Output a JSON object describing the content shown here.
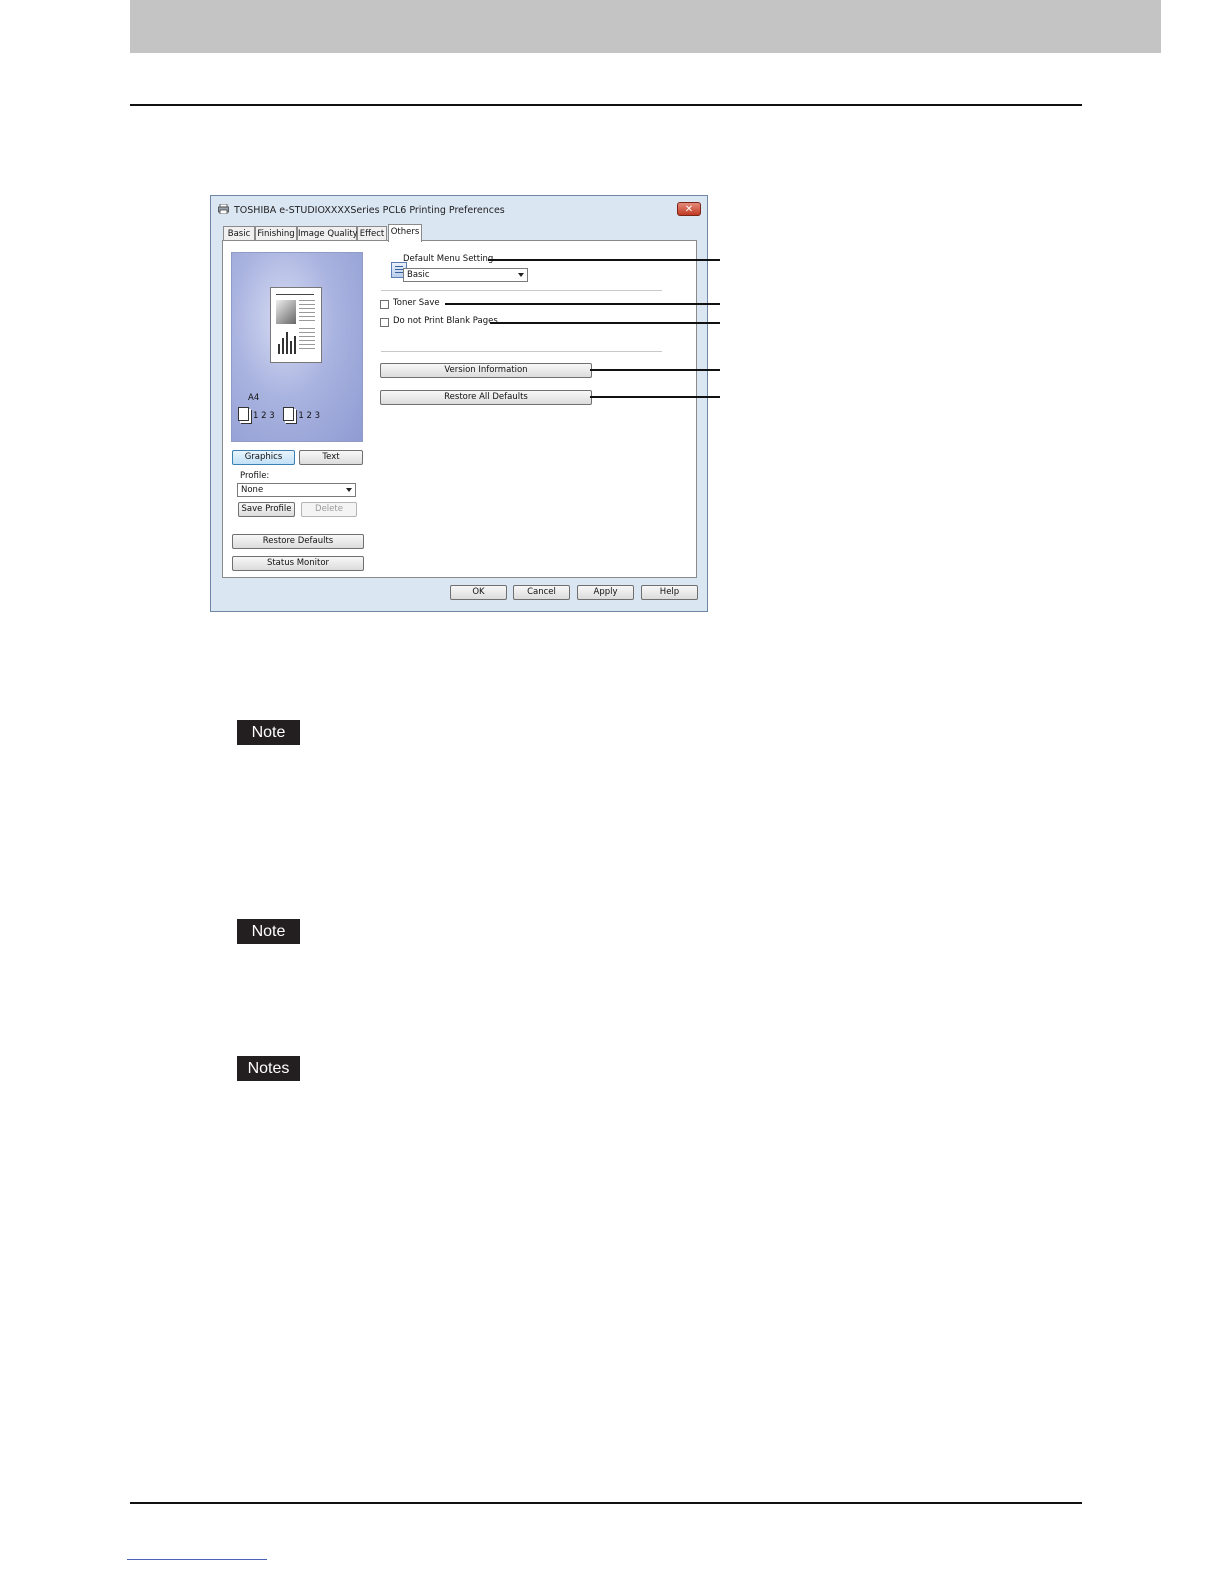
{
  "dialog": {
    "title": "TOSHIBA e-STUDIOXXXXSeries PCL6 Printing Preferences",
    "close_label": "✕",
    "tabs": [
      "Basic",
      "Finishing",
      "Image Quality",
      "Effect",
      "Others"
    ],
    "active_tab": "Others",
    "preview": {
      "paper_size": "A4",
      "copies_label": "1 2 3"
    },
    "mode_buttons": {
      "graphics": "Graphics",
      "text": "Text"
    },
    "profile": {
      "label": "Profile:",
      "selected": "None",
      "save_button": "Save Profile",
      "delete_button": "Delete"
    },
    "restore_defaults": "Restore Defaults",
    "status_monitor": "Status Monitor",
    "default_menu_setting": {
      "label": "Default Menu Setting",
      "selected": "Basic"
    },
    "toner_save": "Toner Save",
    "do_not_print_blank": "Do not Print Blank Pages",
    "version_information": "Version Information",
    "restore_all_defaults": "Restore All Defaults",
    "footer_buttons": {
      "ok": "OK",
      "cancel": "Cancel",
      "apply": "Apply",
      "help": "Help"
    }
  },
  "notes": [
    "Note",
    "Note",
    "Notes"
  ]
}
